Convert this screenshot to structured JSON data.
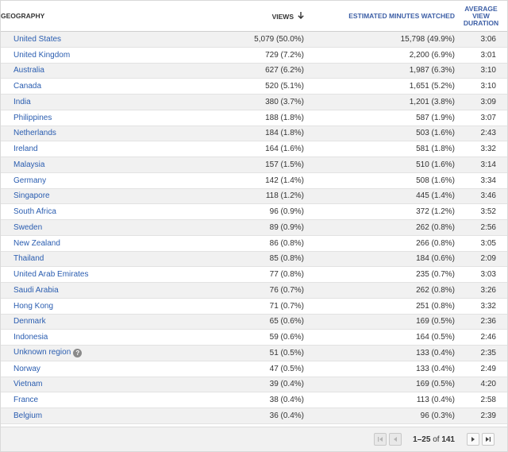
{
  "table": {
    "headers": {
      "geography": "GEOGRAPHY",
      "views": "VIEWS",
      "minutes": "ESTIMATED MINUTES WATCHED",
      "avg_line1": "AVERAGE",
      "avg_line2": "VIEW",
      "avg_line3": "DURATION"
    },
    "sort_icon": "arrow-down-icon",
    "rows": [
      {
        "geo": "United States",
        "views": "5,079 (50.0%)",
        "minutes": "15,798 (49.9%)",
        "avg": "3:06"
      },
      {
        "geo": "United Kingdom",
        "views": "729 (7.2%)",
        "minutes": "2,200 (6.9%)",
        "avg": "3:01"
      },
      {
        "geo": "Australia",
        "views": "627 (6.2%)",
        "minutes": "1,987 (6.3%)",
        "avg": "3:10"
      },
      {
        "geo": "Canada",
        "views": "520 (5.1%)",
        "minutes": "1,651 (5.2%)",
        "avg": "3:10"
      },
      {
        "geo": "India",
        "views": "380 (3.7%)",
        "minutes": "1,201 (3.8%)",
        "avg": "3:09"
      },
      {
        "geo": "Philippines",
        "views": "188 (1.8%)",
        "minutes": "587 (1.9%)",
        "avg": "3:07"
      },
      {
        "geo": "Netherlands",
        "views": "184 (1.8%)",
        "minutes": "503 (1.6%)",
        "avg": "2:43"
      },
      {
        "geo": "Ireland",
        "views": "164 (1.6%)",
        "minutes": "581 (1.8%)",
        "avg": "3:32"
      },
      {
        "geo": "Malaysia",
        "views": "157 (1.5%)",
        "minutes": "510 (1.6%)",
        "avg": "3:14"
      },
      {
        "geo": "Germany",
        "views": "142 (1.4%)",
        "minutes": "508 (1.6%)",
        "avg": "3:34"
      },
      {
        "geo": "Singapore",
        "views": "118 (1.2%)",
        "minutes": "445 (1.4%)",
        "avg": "3:46"
      },
      {
        "geo": "South Africa",
        "views": "96 (0.9%)",
        "minutes": "372 (1.2%)",
        "avg": "3:52"
      },
      {
        "geo": "Sweden",
        "views": "89 (0.9%)",
        "minutes": "262 (0.8%)",
        "avg": "2:56"
      },
      {
        "geo": "New Zealand",
        "views": "86 (0.8%)",
        "minutes": "266 (0.8%)",
        "avg": "3:05"
      },
      {
        "geo": "Thailand",
        "views": "85 (0.8%)",
        "minutes": "184 (0.6%)",
        "avg": "2:09"
      },
      {
        "geo": "United Arab Emirates",
        "views": "77 (0.8%)",
        "minutes": "235 (0.7%)",
        "avg": "3:03"
      },
      {
        "geo": "Saudi Arabia",
        "views": "76 (0.7%)",
        "minutes": "262 (0.8%)",
        "avg": "3:26"
      },
      {
        "geo": "Hong Kong",
        "views": "71 (0.7%)",
        "minutes": "251 (0.8%)",
        "avg": "3:32"
      },
      {
        "geo": "Denmark",
        "views": "65 (0.6%)",
        "minutes": "169 (0.5%)",
        "avg": "2:36"
      },
      {
        "geo": "Indonesia",
        "views": "59 (0.6%)",
        "minutes": "164 (0.5%)",
        "avg": "2:46"
      },
      {
        "geo": "Unknown region",
        "views": "51 (0.5%)",
        "minutes": "133 (0.4%)",
        "avg": "2:35",
        "help": "?"
      },
      {
        "geo": "Norway",
        "views": "47 (0.5%)",
        "minutes": "133 (0.4%)",
        "avg": "2:49"
      },
      {
        "geo": "Vietnam",
        "views": "39 (0.4%)",
        "minutes": "169 (0.5%)",
        "avg": "4:20"
      },
      {
        "geo": "France",
        "views": "38 (0.4%)",
        "minutes": "113 (0.4%)",
        "avg": "2:58"
      },
      {
        "geo": "Belgium",
        "views": "36 (0.4%)",
        "minutes": "96 (0.3%)",
        "avg": "2:39"
      }
    ]
  },
  "pager": {
    "range": "1–25",
    "of_label": "of",
    "total": "141",
    "icons": {
      "first": "first-page-icon",
      "prev": "previous-page-icon",
      "next": "next-page-icon",
      "last": "last-page-icon"
    }
  },
  "colors": {
    "link": "#2a5db0",
    "header_accent": "#3d5fa6",
    "row_alt": "#f1f1f1",
    "text": "#333333"
  }
}
